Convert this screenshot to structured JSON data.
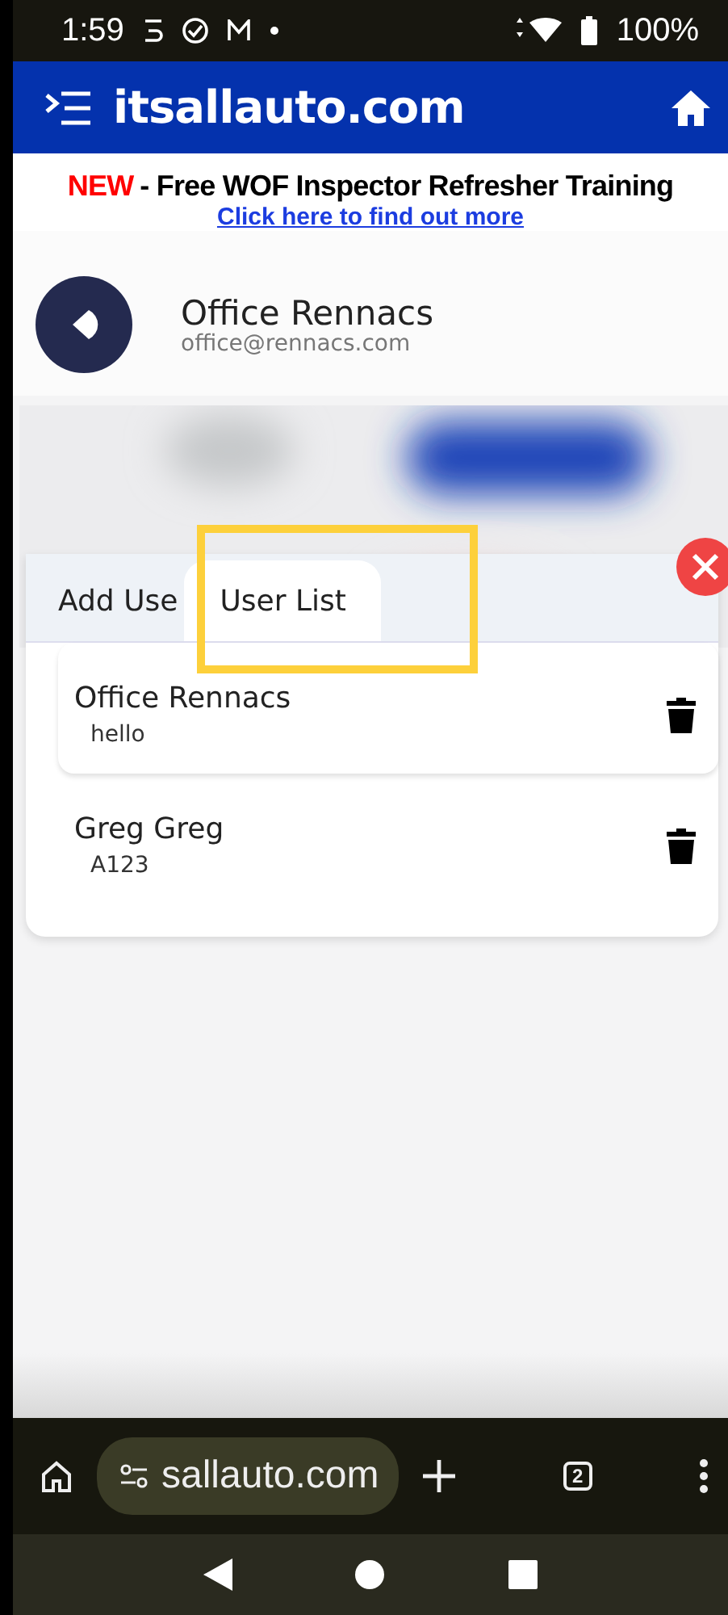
{
  "status_bar": {
    "time": "1:59",
    "battery": "100%"
  },
  "app_bar": {
    "title": "itsallauto.com"
  },
  "banner": {
    "badge": "NEW",
    "headline": "- Free WOF Inspector Refresher Training",
    "link": "Click here to find out more"
  },
  "profile": {
    "name": "Office Rennacs",
    "email": "office@rennacs.com"
  },
  "tabs": [
    {
      "label": "Add Use",
      "selected": false
    },
    {
      "label": "User List",
      "selected": true
    }
  ],
  "users": [
    {
      "name": "Office Rennacs",
      "code": "hello"
    },
    {
      "name": "Greg Greg",
      "code": "A123"
    }
  ],
  "browser_bar": {
    "url": "sallauto.com",
    "tab_count": "2"
  }
}
